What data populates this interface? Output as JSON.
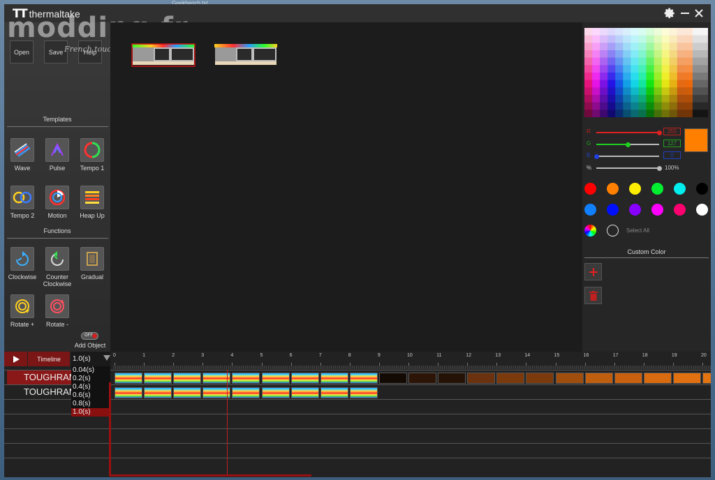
{
  "desktop": {
    "window_caption": "Geekbench.txt"
  },
  "titlebar": {
    "brand": "thermaltake",
    "settings_icon": "gear-icon",
    "minimize_icon": "minimize-icon",
    "close_icon": "close-icon"
  },
  "watermark": {
    "text": "modding.fr",
    "subtext": "French touch"
  },
  "file_buttons": [
    {
      "label": "Open"
    },
    {
      "label": "Save"
    },
    {
      "label": "Help"
    }
  ],
  "templates": {
    "title": "Templates",
    "items": [
      {
        "label": "Wave",
        "icon": "wave-icon"
      },
      {
        "label": "Pulse",
        "icon": "pulse-icon"
      },
      {
        "label": "Tempo 1",
        "icon": "tempo-1-icon"
      },
      {
        "label": "Tempo 2",
        "icon": "tempo-2-icon"
      },
      {
        "label": "Motion",
        "icon": "motion-icon"
      },
      {
        "label": "Heap Up",
        "icon": "heap-up-icon"
      }
    ]
  },
  "functions": {
    "title": "Functions",
    "items": [
      {
        "label": "Clockwise",
        "icon": "clockwise-icon"
      },
      {
        "label": "Counter\nClockwise",
        "icon": "counter-clockwise-icon"
      },
      {
        "label": "Gradual",
        "icon": "gradual-icon"
      },
      {
        "label": "Rotate +",
        "icon": "rotate-plus-icon"
      },
      {
        "label": "Rotate -",
        "icon": "rotate-minus-icon"
      }
    ]
  },
  "add_object": {
    "toggle_label": "OFF",
    "label": "Add Object"
  },
  "color_panel": {
    "r": {
      "label": "R",
      "value": "255",
      "fraction": 1.0,
      "color": "#e02020"
    },
    "g": {
      "label": "G",
      "value": "127",
      "fraction": 0.5,
      "color": "#20d020"
    },
    "b": {
      "label": "B",
      "value": "0",
      "fraction": 0.0,
      "color": "#2040e0"
    },
    "brightness": {
      "label": "%",
      "value": "100%",
      "fraction": 1.0
    },
    "selected_color": "#ff8000",
    "preset_colors": [
      "#ff0000",
      "#ff8000",
      "#ffee00",
      "#00ee30",
      "#00eeee",
      "#000000",
      "#1080ff",
      "#0010ff",
      "#8800ff",
      "#ff00ff",
      "#ff0070",
      "#ffffff"
    ],
    "rainbow_icon": "color-wheel-icon",
    "select_all": "Select All",
    "custom_color_title": "Custom Color",
    "add_icon": "plus-icon",
    "delete_icon": "trash-icon"
  },
  "timeline": {
    "play_icon": "play-icon",
    "label": "Timeline",
    "interval_value": "1.0(s)",
    "interval_options": [
      "0.04(s)",
      "0.2(s)",
      "0.4(s)",
      "0.6(s)",
      "0.8(s)",
      "1.0(s)"
    ],
    "selected_option": "1.0(s)",
    "ruler_ticks": [
      "0",
      "1",
      "2",
      "3",
      "4",
      "5",
      "6",
      "7",
      "8",
      "9",
      "10",
      "11",
      "12",
      "13",
      "14",
      "15",
      "16",
      "17",
      "18",
      "19",
      "20"
    ],
    "tracks": [
      {
        "name": "TOUGHRAM",
        "selected": true
      },
      {
        "name": "TOUGHRAM",
        "selected": false
      }
    ],
    "track1_solid_clips": [
      "#140a04",
      "#2c1406",
      "#241206",
      "#6a320e",
      "#7a3a0c",
      "#7a3a0c",
      "#a04e0e",
      "#c05e10",
      "#c86010",
      "#d86a10",
      "#e07010",
      "#e47410",
      "#ec7a10"
    ]
  }
}
